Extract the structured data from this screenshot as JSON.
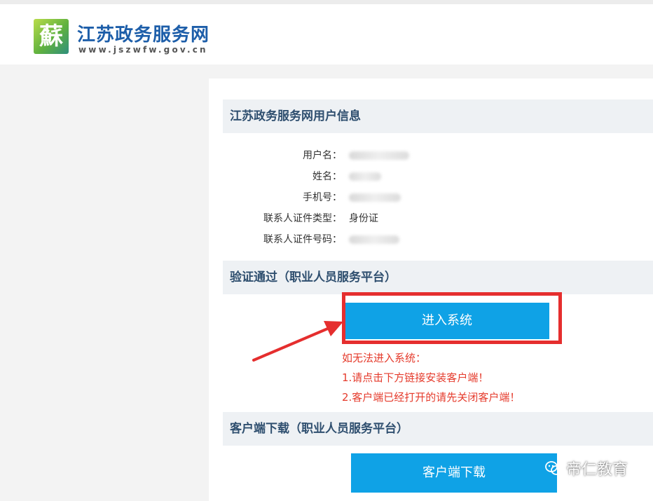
{
  "header": {
    "logo_glyph": "蘇",
    "site_title": "江苏政务服务网",
    "site_url": "www.jszwfw.gov.cn"
  },
  "user_info": {
    "section_title": "江苏政务服务网用户信息",
    "rows": [
      {
        "label": "用户名：",
        "value": ""
      },
      {
        "label": "姓名：",
        "value": ""
      },
      {
        "label": "手机号：",
        "value": ""
      },
      {
        "label": "联系人证件类型：",
        "value": "身份证"
      },
      {
        "label": "联系人证件号码：",
        "value": ""
      }
    ]
  },
  "verify": {
    "section_title": "验证通过（职业人员服务平台）",
    "enter_button": "进入系统",
    "notes": [
      "如无法进入系统：",
      "1.请点击下方链接安装客户端！",
      "2.客户端已经打开的请先关闭客户端！"
    ]
  },
  "download": {
    "section_title": "客户端下载（职业人员服务平台）",
    "download_button": "客户端下载"
  },
  "watermark": {
    "text": "帝仁教育",
    "icon": "wechat-icon"
  },
  "colors": {
    "brand_blue": "#1d5ea9",
    "button_blue": "#0fa2e6",
    "annotation_red": "#e52e2e"
  }
}
